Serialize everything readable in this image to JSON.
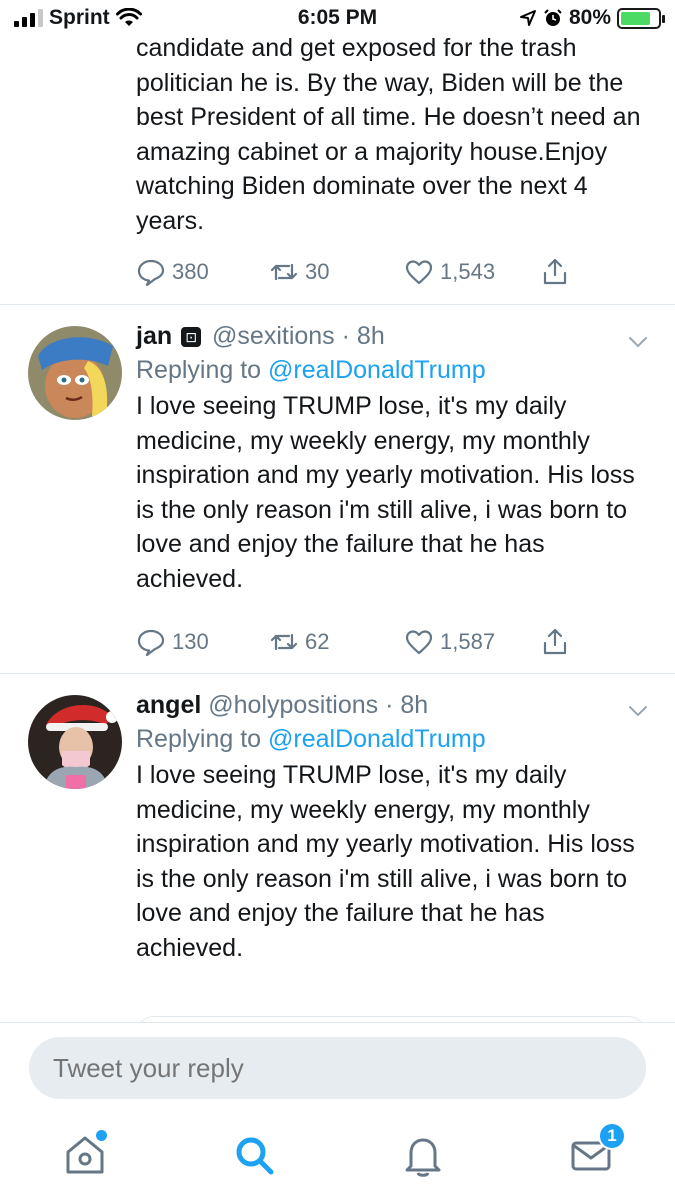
{
  "status_bar": {
    "carrier": "Sprint",
    "time": "6:05 PM",
    "battery": "80%",
    "battery_level": 0.8
  },
  "tweets": [
    {
      "text": "candidate and get exposed for the trash politician he is. By the way, Biden will be the best President of all time. He doesn’t need an amazing cabinet or a majority house.Enjoy watching Biden dominate over the next 4 years.",
      "replies": "380",
      "retweets": "30",
      "likes": "1,543"
    },
    {
      "name": "jan",
      "handle": "@sexitions",
      "time": "· 8h",
      "replying_prefix": "Replying to ",
      "replying_to": "@realDonaldTrump",
      "text": "I love seeing TRUMP lose, it's my daily medicine, my weekly energy, my monthly inspiration and my yearly motivation. His loss is the only reason i'm still alive, i was born to love and enjoy the failure that he has achieved.",
      "replies": "130",
      "retweets": "62",
      "likes": "1,587"
    },
    {
      "name": "angel",
      "handle": "@holypositions",
      "time": "· 8h",
      "replying_prefix": "Replying to ",
      "replying_to": "@realDonaldTrump",
      "text": "I love seeing TRUMP lose, it's my daily medicine, my weekly energy, my monthly inspiration and my yearly motivation. His loss is the only reason i'm still alive, i was born to love and enjoy the failure that he has achieved."
    }
  ],
  "reply": {
    "placeholder": "Tweet your reply"
  },
  "tab_bar": {
    "items": [
      "home-icon",
      "search-icon",
      "bell-icon",
      "mail-icon"
    ],
    "messages_badge": "1"
  },
  "colors": {
    "accent": "#1da1f2",
    "secondary_text": "#657786",
    "divider": "#e1e8ed"
  }
}
